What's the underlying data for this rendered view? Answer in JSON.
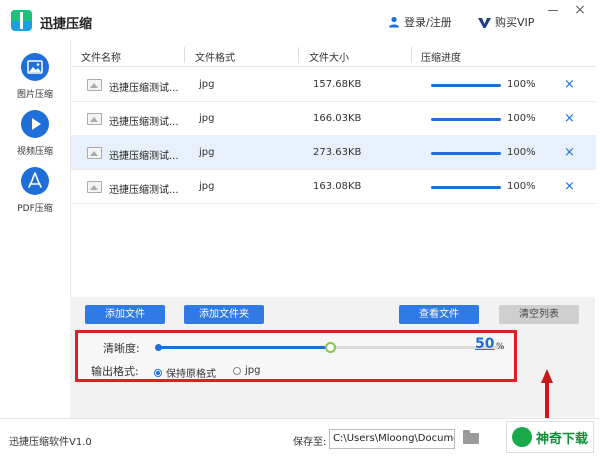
{
  "app": {
    "title": "迅捷压缩",
    "login_label": "登录/注册",
    "vip_label": "购买VIP"
  },
  "sidebar": {
    "items": [
      {
        "label": "图片压缩",
        "icon": "image-icon"
      },
      {
        "label": "视频压缩",
        "icon": "play-icon"
      },
      {
        "label": "PDF压缩",
        "icon": "pdf-icon"
      }
    ]
  },
  "list": {
    "headers": {
      "name": "文件名称",
      "format": "文件格式",
      "size": "文件大小",
      "progress": "压缩进度"
    },
    "rows": [
      {
        "name": "迅捷压缩测试...",
        "format": "jpg",
        "size": "157.68KB",
        "progress_pct": 100,
        "progress_label": "100%"
      },
      {
        "name": "迅捷压缩测试...",
        "format": "jpg",
        "size": "166.03KB",
        "progress_pct": 100,
        "progress_label": "100%"
      },
      {
        "name": "迅捷压缩测试...",
        "format": "jpg",
        "size": "273.63KB",
        "progress_pct": 100,
        "progress_label": "100%"
      },
      {
        "name": "迅捷压缩测试...",
        "format": "jpg",
        "size": "163.08KB",
        "progress_pct": 100,
        "progress_label": "100%"
      }
    ],
    "delete_glyph": "×"
  },
  "toolbar": {
    "add_file": "添加文件",
    "add_folder": "添加文件夹",
    "view_files": "查看文件",
    "clear_list": "清空列表"
  },
  "settings": {
    "clarity_label": "清晰度:",
    "clarity_value": "50",
    "clarity_fraction": 0.5,
    "clarity_unit": "%",
    "format_label": "输出格式:",
    "format_options": [
      {
        "label": "保持原格式",
        "selected": true
      },
      {
        "label": "jpg",
        "selected": false
      }
    ]
  },
  "status": {
    "version": "迅捷压缩软件V1.0",
    "save_label": "保存至:",
    "save_path": "C:\\Users\\Mloong\\Documents"
  },
  "watermark": {
    "text": "神奇下载"
  },
  "colors": {
    "accent": "#1e6fd9",
    "highlight_box": "#e02020",
    "slider_thumb": "#7ecb4c"
  }
}
